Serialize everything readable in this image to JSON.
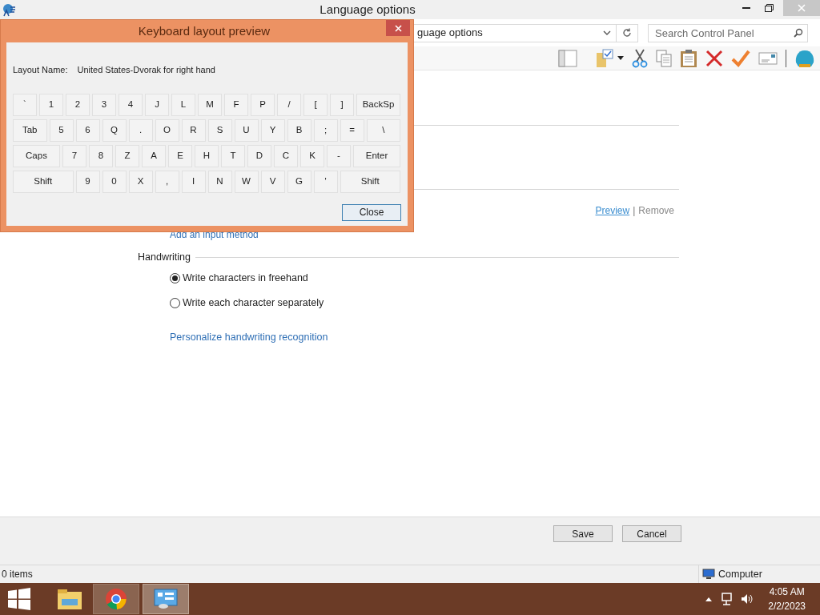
{
  "window": {
    "title": "Language options"
  },
  "address_bar": {
    "path": "guage options"
  },
  "search": {
    "placeholder": "Search Control Panel"
  },
  "content": {
    "links": {
      "preview": "Preview",
      "separator": "|",
      "remove": "Remove"
    },
    "add_input_method": "Add an input method",
    "handwriting": {
      "heading": "Handwriting",
      "options": [
        {
          "label": "Write characters in freehand",
          "selected": true
        },
        {
          "label": "Write each character separately",
          "selected": false
        }
      ],
      "link": "Personalize handwriting recognition"
    }
  },
  "buttons": [
    "Save",
    "Cancel"
  ],
  "status_bar": {
    "items": "0 items",
    "zone": "Computer"
  },
  "dialog": {
    "title": "Keyboard layout preview",
    "layout_label": "Layout Name:",
    "layout_name": "United States-Dvorak for right hand",
    "rows": [
      {
        "keys": [
          "`",
          "1",
          "2",
          "3",
          "4",
          "J",
          "L",
          "M",
          "F",
          "P",
          "/",
          "[",
          "]",
          "BackSp"
        ]
      },
      {
        "keys": [
          "Tab",
          "5",
          "6",
          "Q",
          ".",
          "O",
          "R",
          "S",
          "U",
          "Y",
          "B",
          ";",
          "=",
          "\\"
        ]
      },
      {
        "keys": [
          "Caps",
          "7",
          "8",
          "Z",
          "A",
          "E",
          "H",
          "T",
          "D",
          "C",
          "K",
          "-",
          "Enter"
        ]
      },
      {
        "keys": [
          "Shift",
          "9",
          "0",
          "X",
          ",",
          "I",
          "N",
          "W",
          "V",
          "G",
          "'",
          "Shift"
        ]
      }
    ],
    "close_button": "Close"
  },
  "taskbar": {
    "time": "4:05 AM",
    "date": "2/2/2023"
  }
}
